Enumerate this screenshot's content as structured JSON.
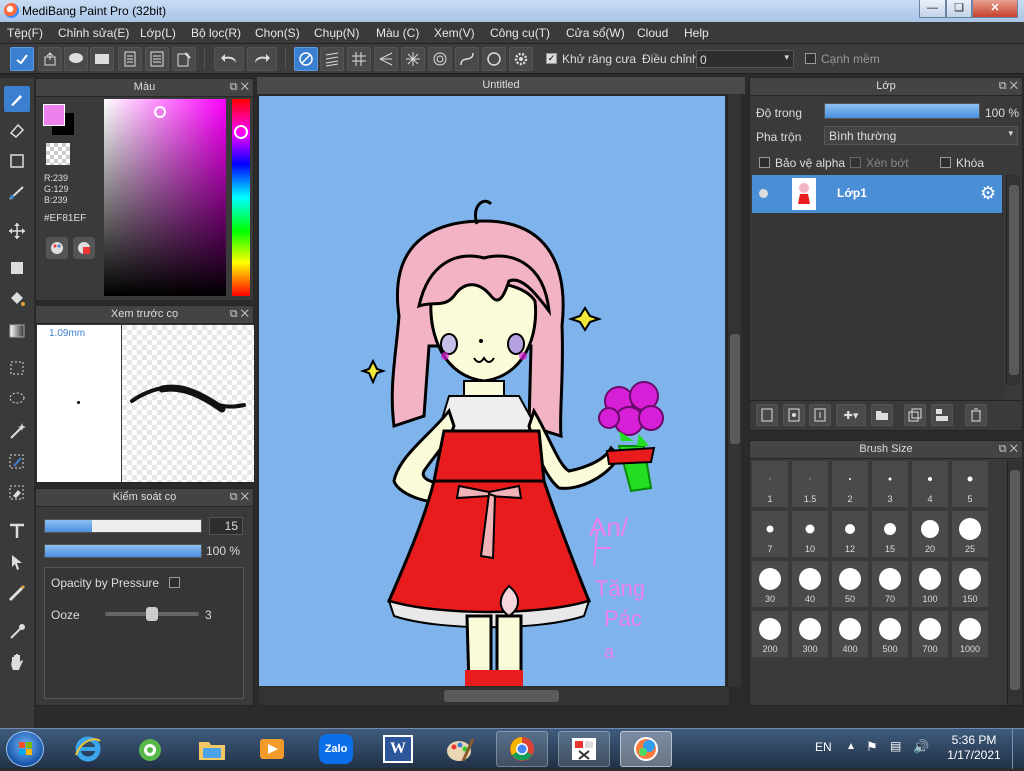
{
  "app": {
    "title": "MediBang Paint Pro (32bit)"
  },
  "window_controls": {
    "minimize": "—",
    "restore": "❏",
    "close": "✕"
  },
  "menu": [
    "Tệp(F)",
    "Chỉnh sửa(E)",
    "Lớp(L)",
    "Bộ lọc(R)",
    "Chọn(S)",
    "Chụp(N)",
    "Màu (C)",
    "Xem(V)",
    "Công cụ(T)",
    "Cửa sổ(W)",
    "Cloud",
    "Help"
  ],
  "toolbar": {
    "antialias_label": "Khử răng cưa",
    "antialias_checked": true,
    "adjust_label": "Điều chỉnh",
    "adjust_value": "0",
    "soft_edge_label": "Cạnh mềm",
    "soft_edge_checked": false
  },
  "color_panel": {
    "title": "Màu",
    "r": "R:239",
    "g": "G:129",
    "b": "B:239",
    "hex": "#EF81EF",
    "primary_color": "#ef81ef",
    "secondary_color": "#000000"
  },
  "brush_preview": {
    "title": "Xem trước cọ",
    "size_text": "1.09mm"
  },
  "brush_control": {
    "title": "Kiểm soát cọ",
    "size_value": "15",
    "size_fraction": 0.3,
    "opacity_value": "100 %",
    "opacity_fraction": 1.0,
    "opacity_by_pressure_label": "Opacity by Pressure",
    "opacity_by_pressure_checked": false,
    "ooze_label": "Ooze",
    "ooze_value": "3",
    "ooze_fraction": 0.5
  },
  "document": {
    "title": "Untitled"
  },
  "layer_panel": {
    "title": "Lớp",
    "opacity_label": "Độ trong",
    "opacity_value": "100 %",
    "opacity_fraction": 1.0,
    "blend_label": "Pha trộn",
    "blend_value": "Bình thường",
    "protect_alpha_label": "Bảo vệ alpha",
    "clipping_label": "Xén bớt",
    "lock_label": "Khóa",
    "layers": [
      {
        "name": "Lớp1",
        "visible": true,
        "selected": true
      }
    ]
  },
  "brush_size_panel": {
    "title": "Brush Size",
    "sizes": [
      "1",
      "1.5",
      "2",
      "3",
      "4",
      "5",
      "7",
      "10",
      "12",
      "15",
      "20",
      "25",
      "30",
      "40",
      "50",
      "70",
      "100",
      "150",
      "200",
      "300",
      "400",
      "500",
      "700",
      "1000"
    ]
  },
  "canvas_text": {
    "line1": "An/",
    "line2": "Tặng",
    "line3": "Pác",
    "line4": "a"
  },
  "taskbar": {
    "apps": [
      "start-orb",
      "internet-explorer",
      "cococ",
      "file-explorer",
      "media-player",
      "zalo",
      "word",
      "paint",
      "chrome",
      "snipping",
      "medibang"
    ],
    "zalo_label": "Zalo",
    "word_label": "W",
    "lang": "EN",
    "time": "5:36 PM",
    "date": "1/17/2021"
  },
  "colors": {
    "accent": "#3b7fd0",
    "canvas_bg": "#7fb3ec",
    "dress": "#e81c1c",
    "hair": "#f2b3c4",
    "skin": "#fbfbd9",
    "flowers": "#d61fd6",
    "signature": "#ef81ef"
  }
}
